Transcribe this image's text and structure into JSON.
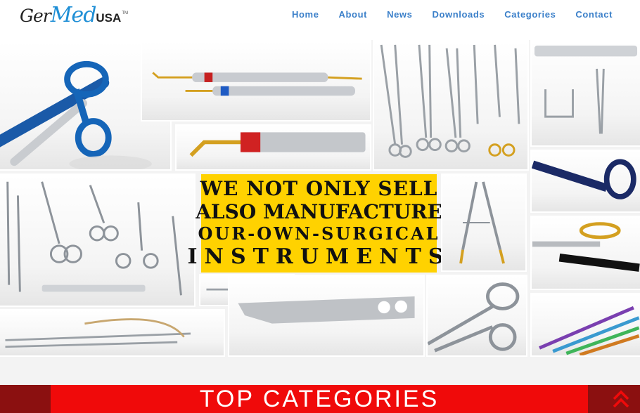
{
  "brand": {
    "logo_part1": "Ger",
    "logo_part2": "Med",
    "logo_part3": "USA",
    "logo_tm": "TM"
  },
  "nav": {
    "items": [
      "Home",
      "About",
      "News",
      "Downloads",
      "Categories",
      "Contact"
    ]
  },
  "banner": {
    "line1": "WE NOT ONLY SELL",
    "line2": "ALSO MANUFACTURE",
    "line3": "OUR-OWN-SURGICAL",
    "line4": "INSTRUMENTS"
  },
  "section": {
    "title": "TOP CATEGORIES"
  },
  "icons": {
    "scroll_top": "double-chevron-up-icon"
  },
  "colors": {
    "nav_link": "#3a7fc9",
    "banner_bg": "#ffd200",
    "category_bar": "#f00a0a",
    "category_bar_dark": "#8b1010",
    "logo_accent": "#1f8fd6"
  }
}
